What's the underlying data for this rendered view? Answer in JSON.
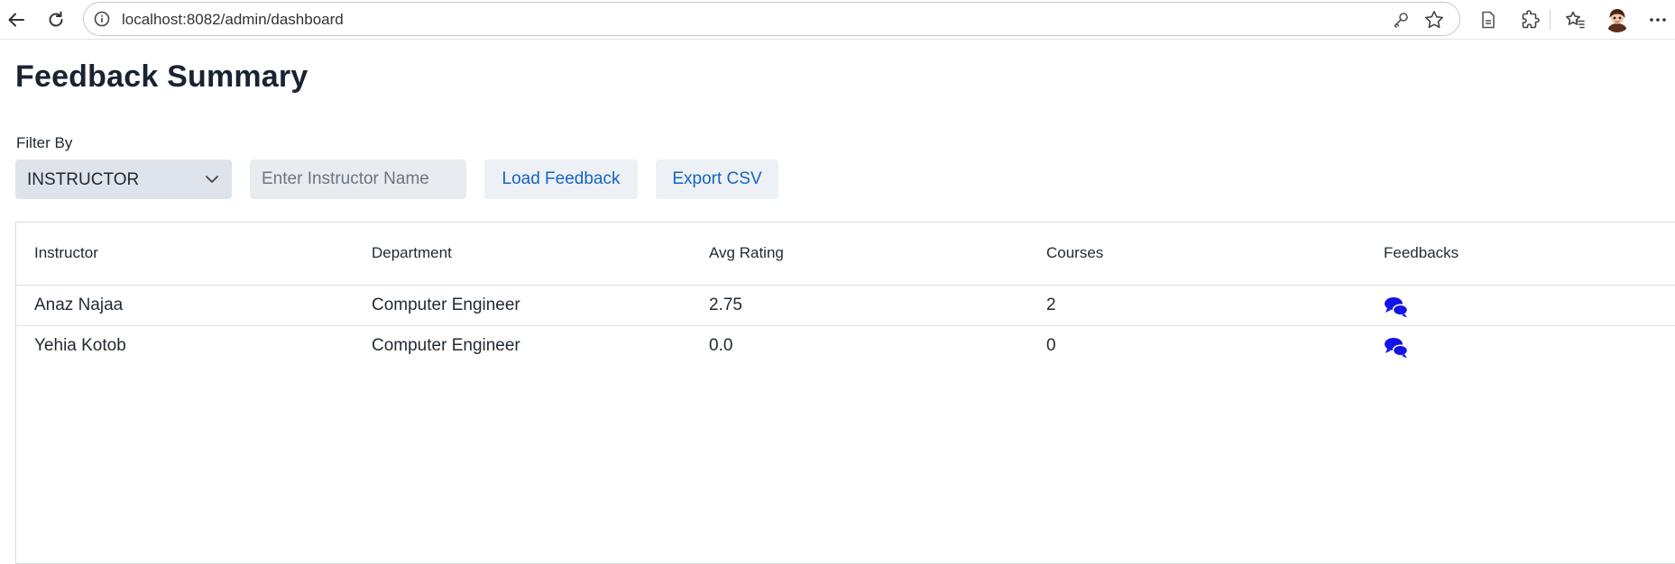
{
  "browser": {
    "url": "localhost:8082/admin/dashboard",
    "icons": [
      "back-arrow-icon",
      "reload-icon",
      "info-icon",
      "key-icon",
      "star-icon",
      "reader-icon",
      "extensions-icon",
      "favorites-icon",
      "avatar",
      "more-icon"
    ]
  },
  "page": {
    "title": "Feedback Summary"
  },
  "filter": {
    "label": "Filter By",
    "selected": "INSTRUCTOR",
    "input_placeholder": "Enter Instructor Name",
    "input_value": "",
    "load_button": "Load Feedback",
    "export_button": "Export CSV"
  },
  "table": {
    "headers": [
      "Instructor",
      "Department",
      "Avg Rating",
      "Courses",
      "Feedbacks"
    ],
    "rows": [
      {
        "instructor": "Anaz Najaa",
        "department": "Computer Engineer",
        "avg_rating": "2.75",
        "courses": "2",
        "feedback_icon": "comments-icon"
      },
      {
        "instructor": "Yehia Kotob",
        "department": "Computer Engineer",
        "avg_rating": "0.0",
        "courses": "0",
        "feedback_icon": "comments-icon"
      }
    ]
  },
  "colors": {
    "accent_text": "#1565c0",
    "feedback_icon": "#1414e6",
    "select_bg": "#dfe3ea"
  }
}
